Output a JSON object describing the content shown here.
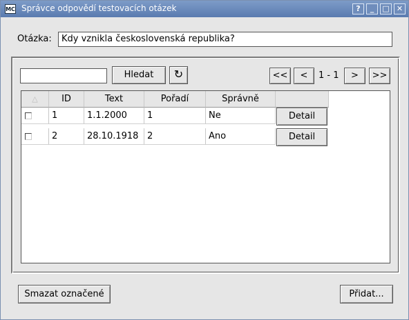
{
  "window": {
    "icon_text": "MC",
    "title": "Správce odpovědí testovacích otázek",
    "buttons": [
      "?",
      "_",
      "□",
      "✕"
    ]
  },
  "question": {
    "label": "Otázka:",
    "value": "Kdy vznikla československá  republika?"
  },
  "toolbar": {
    "search_value": "",
    "search_label": "Hledat",
    "refresh_icon": "↻",
    "first_label": "<<",
    "prev_label": "<",
    "page_range": "1 - 1",
    "next_label": ">",
    "last_label": ">>"
  },
  "table": {
    "columns": [
      "",
      "ID",
      "Text",
      "Pořadí",
      "Správně",
      ""
    ],
    "rows": [
      {
        "checked": false,
        "id": "1",
        "text": "1.1.2000",
        "order": "1",
        "correct": "Ne",
        "action": "Detail"
      },
      {
        "checked": false,
        "id": "2",
        "text": "28.10.1918",
        "order": "2",
        "correct": "Ano",
        "action": "Detail"
      }
    ]
  },
  "footer": {
    "delete_label": "Smazat označené",
    "add_label": "Přidat..."
  }
}
